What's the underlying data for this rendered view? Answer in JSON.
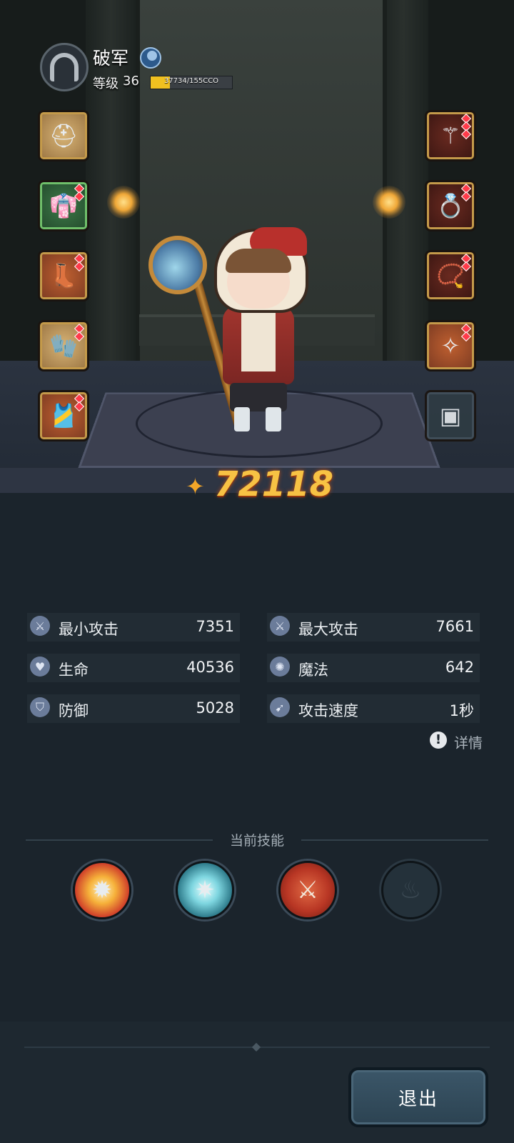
{
  "player": {
    "name": "破军",
    "level_label": "等级",
    "level": "36",
    "xp_text": "37734/155CCO",
    "xp_fraction": 0.24
  },
  "equipment": {
    "left": [
      {
        "name": "hood",
        "icon": "hood-icon",
        "rarity": "cream",
        "gems": 0
      },
      {
        "name": "robe",
        "icon": "robe-icon",
        "rarity": "green",
        "gems": 2
      },
      {
        "name": "boots",
        "icon": "boots-icon",
        "rarity": "orange",
        "gems": 2
      },
      {
        "name": "bracer",
        "icon": "bracer-icon",
        "rarity": "cream",
        "gems": 2
      },
      {
        "name": "belt",
        "icon": "belt-icon",
        "rarity": "orange",
        "gems": 2
      }
    ],
    "right": [
      {
        "name": "weapon",
        "icon": "staff-icon",
        "rarity": "dark",
        "gems": 3
      },
      {
        "name": "ring",
        "icon": "ring-icon",
        "rarity": "dark",
        "gems": 2
      },
      {
        "name": "necklace",
        "icon": "necklace-icon",
        "rarity": "dark",
        "gems": 2
      },
      {
        "name": "talisman",
        "icon": "talisman-icon",
        "rarity": "orange",
        "gems": 2
      },
      {
        "name": "locked",
        "icon": "locked-slot-icon",
        "rarity": "locked",
        "gems": 0
      }
    ]
  },
  "power": {
    "value": "72118",
    "icon": "power-icon",
    "color": "#f7c244"
  },
  "stats": [
    {
      "icon": "sword-icon",
      "label": "最小攻击",
      "value": "7351"
    },
    {
      "icon": "sword-icon",
      "label": "最大攻击",
      "value": "7661"
    },
    {
      "icon": "heart-icon",
      "label": "生命",
      "value": "40536"
    },
    {
      "icon": "magic-icon",
      "label": "魔法",
      "value": "642"
    },
    {
      "icon": "shield-icon",
      "label": "防御",
      "value": "5028"
    },
    {
      "icon": "speed-icon",
      "label": "攻击速度",
      "value": "1秒"
    }
  ],
  "details": {
    "icon": "exclamation-icon",
    "label": "详情"
  },
  "skills": {
    "title": "当前技能",
    "items": [
      {
        "icon": "explosion-skill-icon",
        "locked": false
      },
      {
        "icon": "frost-orb-skill-icon",
        "locked": false
      },
      {
        "icon": "crossed-axes-skill-icon",
        "locked": false
      },
      {
        "icon": "fire-skill-icon",
        "locked": true
      }
    ]
  },
  "exit_button": {
    "label": "退出"
  }
}
